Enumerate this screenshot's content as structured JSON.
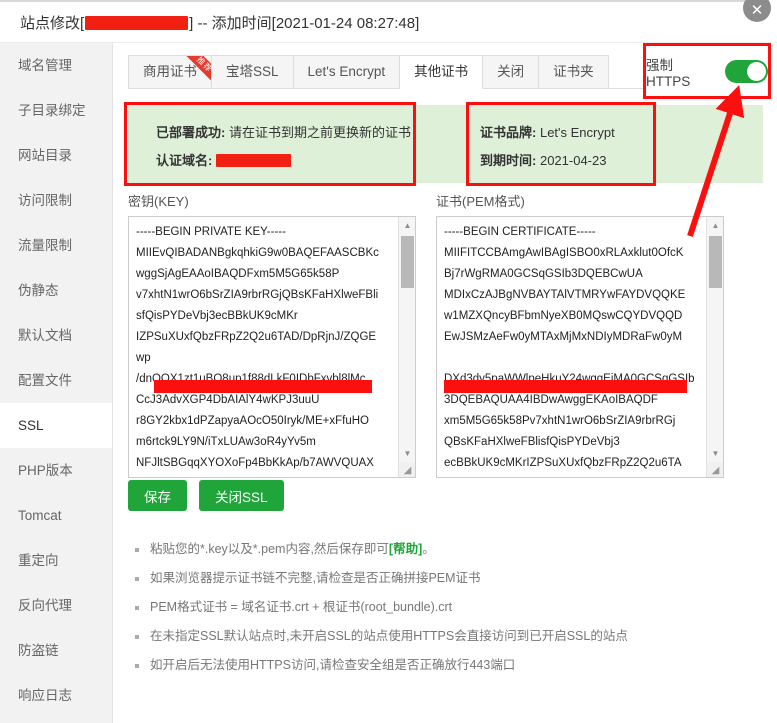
{
  "header": {
    "title_prefix": "站点修改[",
    "title_suffix": "] -- 添加时间[2021-01-24 08:27:48]",
    "close_icon": "close-icon"
  },
  "sidebar": {
    "items": [
      {
        "label": "域名管理",
        "active": false
      },
      {
        "label": "子目录绑定",
        "active": false
      },
      {
        "label": "网站目录",
        "active": false
      },
      {
        "label": "访问限制",
        "active": false
      },
      {
        "label": "流量限制",
        "active": false
      },
      {
        "label": "伪静态",
        "active": false
      },
      {
        "label": "默认文档",
        "active": false
      },
      {
        "label": "配置文件",
        "active": false
      },
      {
        "label": "SSL",
        "active": true
      },
      {
        "label": "PHP版本",
        "active": false
      },
      {
        "label": "Tomcat",
        "active": false
      },
      {
        "label": "重定向",
        "active": false
      },
      {
        "label": "反向代理",
        "active": false
      },
      {
        "label": "防盗链",
        "active": false
      },
      {
        "label": "响应日志",
        "active": false
      }
    ]
  },
  "tabs": [
    {
      "label": "商用证书",
      "active": false,
      "ribbon": "推荐"
    },
    {
      "label": "宝塔SSL",
      "active": false,
      "ribbon": ""
    },
    {
      "label": "Let's Encrypt",
      "active": false,
      "ribbon": ""
    },
    {
      "label": "其他证书",
      "active": true,
      "ribbon": ""
    },
    {
      "label": "关闭",
      "active": false,
      "ribbon": ""
    },
    {
      "label": "证书夹",
      "active": false,
      "ribbon": ""
    }
  ],
  "force_https": {
    "label": "强制HTTPS",
    "enabled": true,
    "accent_color": "#20a53a",
    "highlight_color": "#fb0f0f"
  },
  "status": {
    "deploy_key": "已部署成功:",
    "deploy_value": "请在证书到期之前更换新的证书",
    "domain_key": "认证域名:",
    "domain_value": "",
    "brand_key": "证书品牌:",
    "brand_value": "Let's Encrypt",
    "expire_key": "到期时间:",
    "expire_value": "2021-04-23",
    "background_color": "#dff0d8"
  },
  "key_pane": {
    "label": "密钥(KEY)",
    "content": "-----BEGIN PRIVATE KEY-----\nMIIEvQIBADANBgkqhkiG9w0BAQEFAASCBKc\nwggSjAgEAAoIBAQDFxm5M5G65k58P\nv7xhtN1wrO6bSrZIA9rbrRGjQBsKFaHXlweFBli\nsfQisPYDeVbj3ecBBkUK9cMKr\nIZPSuXUxfQbzFRpZ2Q2u6TAD/DpRjnJ/ZQGE\nwp\n/dnQOX1zt1uBO8up1f88dLkF0IDbFxvbl8lMc\nCcJ3AdvXGP4DbAIAlY4wKPJ3uuU\nr8GY2kbx1dPZapyaAOcO50Iryk/ME+xFfuHO\nm6rtck9LY9N/iTxLUAw3oR4yYv5m\nNFJltSBGqqXYOXoFp4BbKkAp/b7AWVQUAX"
  },
  "pem_pane": {
    "label": "证书(PEM格式)",
    "content": "-----BEGIN CERTIFICATE-----\nMIIFITCCBAmgAwIBAgISBO0xRLAxklut0OfcK\nBj7rWgRMA0GCSqGSIb3DQEBCwUA\nMDIxCzAJBgNVBAYTAlVTMRYwFAYDVQQKE\nw1MZXQncyBFbmNyeXB0MQswCQYDVQQD\nEwJSMzAeFw0yMTAxMjMxNDIyMDRaFw0yM\n\nDXd3dy5paWWlpeHkuY24wggEiMA0GCSqGSIb\n3DQEBAQUAA4IBDwAwggEKAoIBAQDF\nxm5M5G65k58Pv7xhtN1wrO6bSrZIA9rbrRGj\nQBsKFaHXlweFBlisfQisPYDeVbj3\necBBkUK9cMKrIZPSuXUxfQbzFRpZ2Q2u6TA"
  },
  "buttons": {
    "save": "保存",
    "close_ssl": "关闭SSL",
    "color": "#20a53a"
  },
  "notes": [
    {
      "pre": "粘贴您的*.key以及*.pem内容,然后保存即可",
      "link": "[帮助]",
      "post": "。"
    },
    {
      "pre": "如果浏览器提示证书链不完整,请检查是否正确拼接PEM证书",
      "link": "",
      "post": ""
    },
    {
      "pre": "PEM格式证书 = 域名证书.crt + 根证书(root_bundle).crt",
      "link": "",
      "post": ""
    },
    {
      "pre": "在未指定SSL默认站点时,未开启SSL的站点使用HTTPS会直接访问到已开启SSL的站点",
      "link": "",
      "post": ""
    },
    {
      "pre": "如开启后无法使用HTTPS访问,请检查安全组是否正确放行443端口",
      "link": "",
      "post": ""
    }
  ],
  "annotations": {
    "arrow_color": "#fb0f0f",
    "arrow_description": "red-arrow-pointing-to-force-https-toggle"
  }
}
